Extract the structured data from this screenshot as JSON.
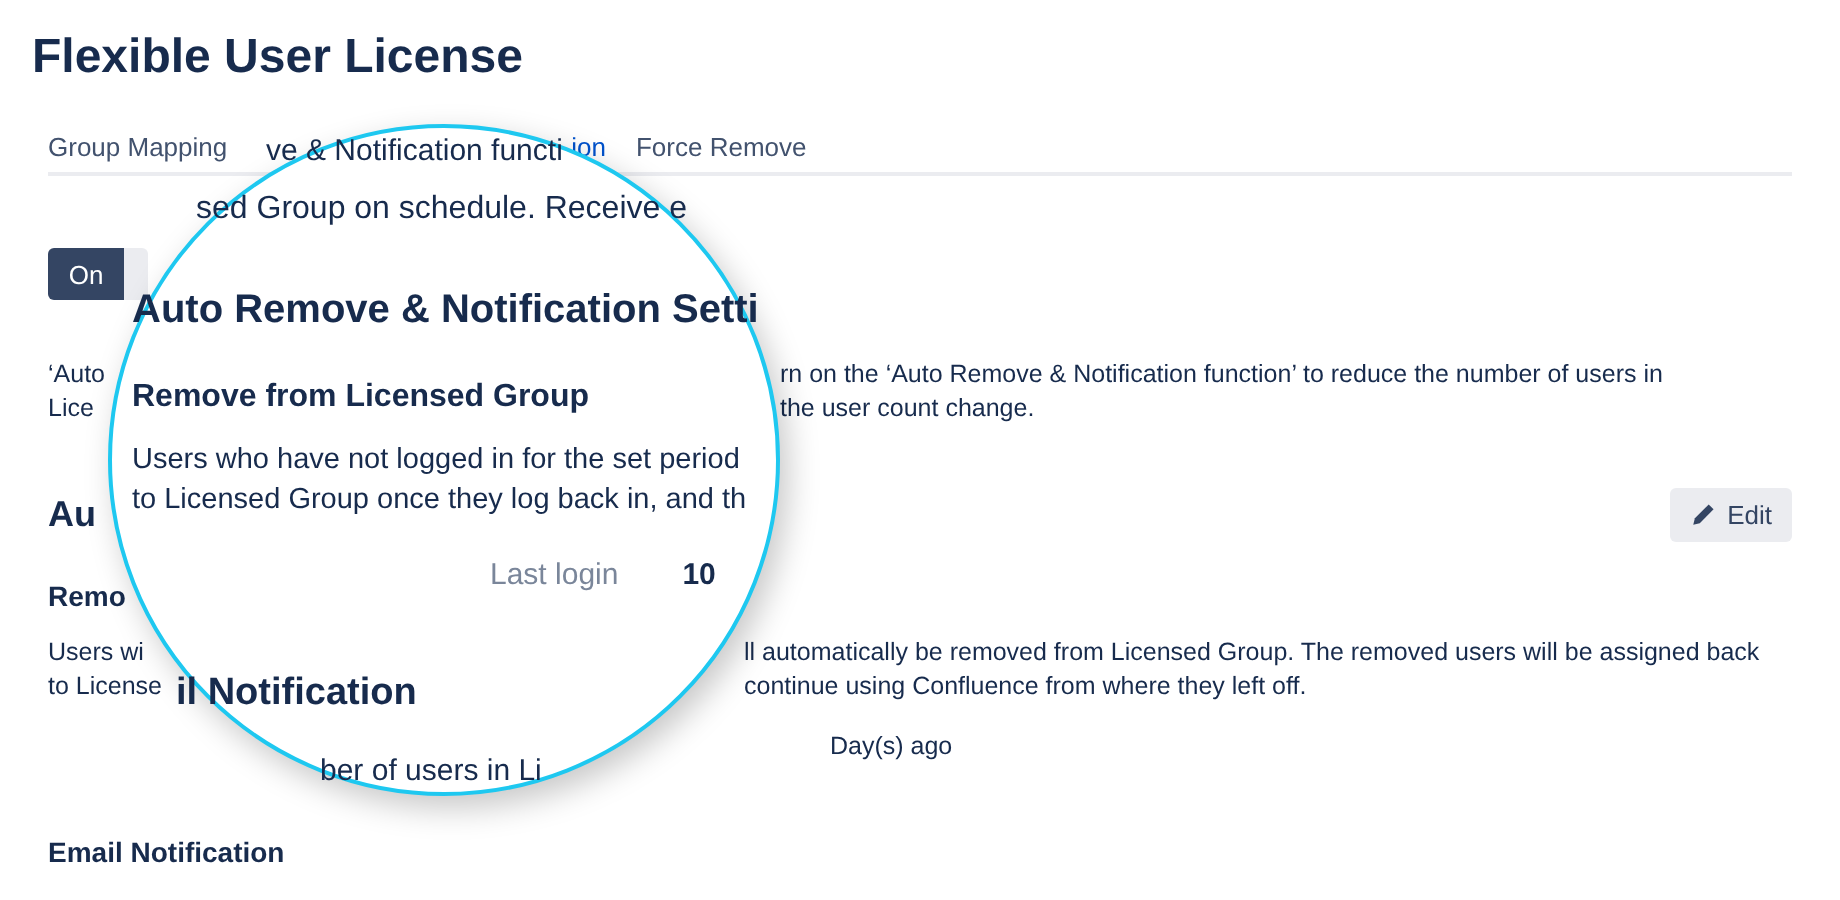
{
  "title": "Flexible User License",
  "tabs": [
    {
      "label": "Group Mapping",
      "selected": false
    },
    {
      "label": "ion",
      "selected": true
    },
    {
      "label": "Force Remove",
      "selected": false
    }
  ],
  "toggle": [
    {
      "label": "On",
      "selected": true
    },
    {
      "selected": false
    }
  ],
  "intro": [
    {
      "start": "‘Auto",
      "end": "rn on the ‘Auto Remove & Notification function’ to reduce the number of users in"
    },
    {
      "start": "Lice",
      "end": "the user count change."
    }
  ],
  "section_heading": "Au",
  "edit_button": "Edit",
  "subheading": "Remo",
  "description": [
    {
      "start": "Users wi",
      "end": "ll automatically be removed from Licensed Group. The removed users will be assigned back"
    },
    {
      "start": "to License",
      "end": "continue using Confluence from where they left off."
    }
  ],
  "days_label": "Day(s) ago",
  "email_heading": "Email Notification",
  "magnifier": {
    "tab_fragment": "ve & Notification functi",
    "intro_fragment": "sed Group on schedule. Receive e",
    "heading": "Auto Remove & Notification Setti",
    "subheading": "Remove from Licensed Group",
    "text_lines": [
      "Users who have not logged in for the set period",
      "to Licensed Group once they log back in, and th"
    ],
    "field_label": "Last login",
    "field_value": "10",
    "email_heading": "il Notification",
    "email_fragment": "ber of users in Li"
  }
}
